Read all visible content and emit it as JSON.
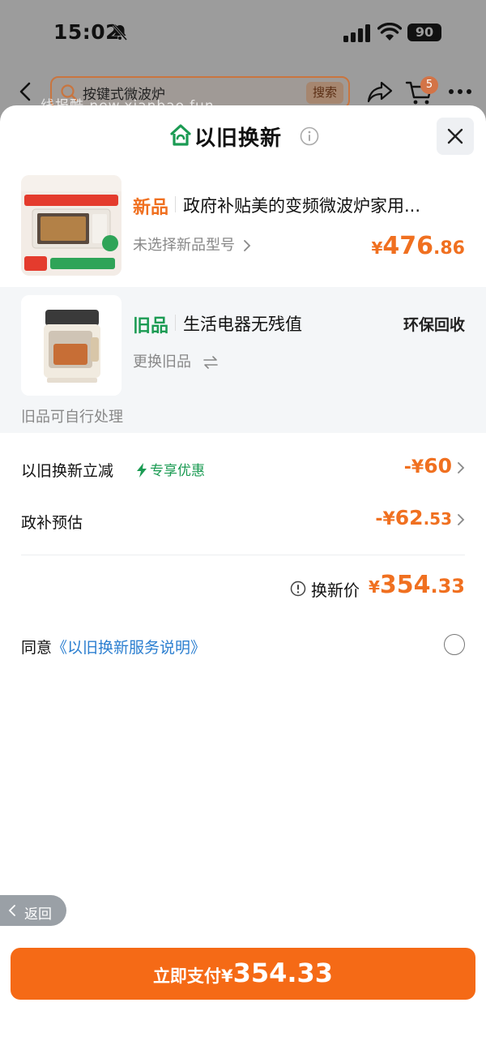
{
  "status_bar": {
    "time": "15:02",
    "battery": "90"
  },
  "background": {
    "search_text": "按键式微波炉",
    "search_button": "搜索",
    "cart_badge": "5",
    "watermark": "线报酷 new.xianbao.fun"
  },
  "sheet": {
    "title": "以旧换新",
    "new_product": {
      "tag": "新品",
      "name": "政府补贴美的变频微波炉家用...",
      "subtitle": "未选择新品型号",
      "price_symbol": "¥",
      "price_int": "476",
      "price_dec": ".86"
    },
    "old_product": {
      "tag": "旧品",
      "name": "生活电器无残值",
      "recycle_label": "环保回收",
      "change_label": "更换旧品",
      "note": "旧品可自行处理"
    },
    "trade_in_discount": {
      "label": "以旧换新立减",
      "badge": "专享优惠",
      "value_prefix": "-¥",
      "value_int": "60",
      "value_dec": ""
    },
    "subsidy": {
      "label": "政补预估",
      "value_prefix": "-¥",
      "value_int": "62",
      "value_dec": ".53"
    },
    "total": {
      "label": "换新价",
      "price_symbol": "¥",
      "price_int": "354",
      "price_dec": ".33"
    },
    "agreement": {
      "prefix": "同意",
      "link": "《以旧换新服务说明》"
    },
    "back_label": "返回",
    "pay_button": {
      "label": "立即支付",
      "symbol": "¥",
      "amount": "354.33"
    }
  },
  "colors": {
    "accent_orange": "#f07020",
    "pay_button": "#f56a16",
    "green": "#1b9b53",
    "link_blue": "#2c7fd0"
  }
}
